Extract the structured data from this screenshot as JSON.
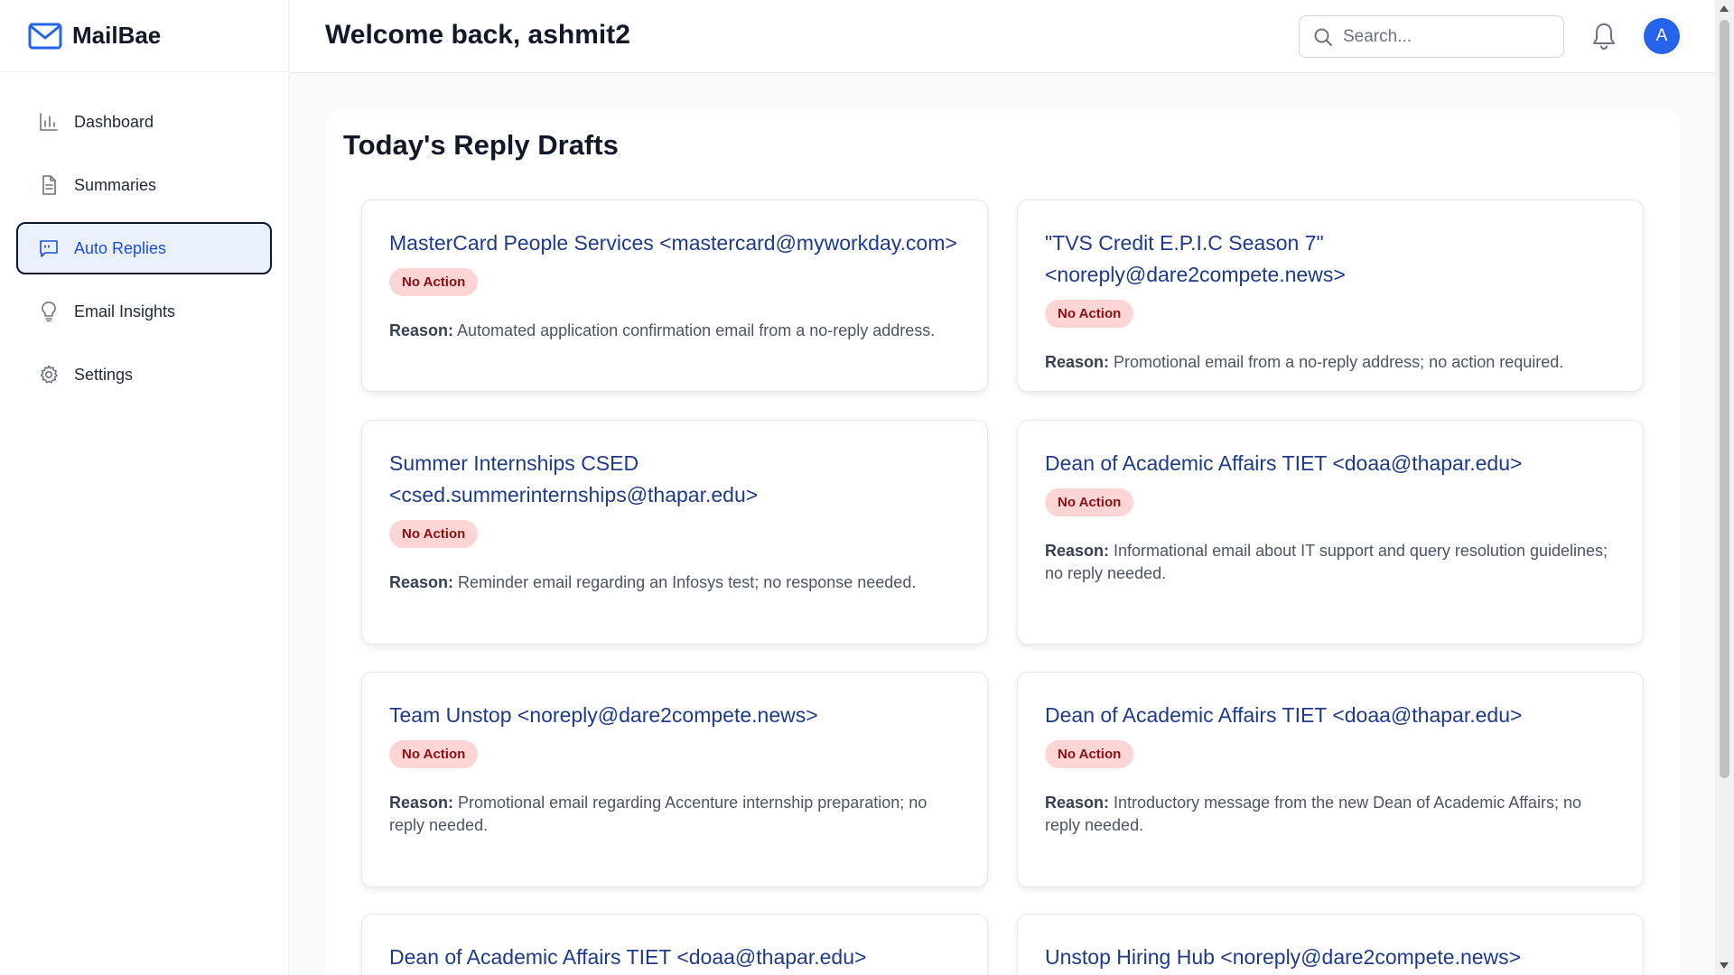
{
  "app": {
    "name": "MailBae"
  },
  "sidebar": {
    "items": [
      {
        "label": "Dashboard",
        "icon": "bar-chart-icon"
      },
      {
        "label": "Summaries",
        "icon": "document-icon"
      },
      {
        "label": "Auto Replies",
        "icon": "message-reply-icon",
        "active": true
      },
      {
        "label": "Email Insights",
        "icon": "lightbulb-icon"
      },
      {
        "label": "Settings",
        "icon": "gear-icon"
      }
    ]
  },
  "header": {
    "welcome": "Welcome back, ashmit2",
    "search_placeholder": "Search...",
    "avatar_initial": "A"
  },
  "main": {
    "title": "Today's Reply Drafts",
    "reason_label": "Reason:",
    "cards": [
      {
        "sender": "MasterCard People Services <mastercard@myworkday.com>",
        "status": "No Action",
        "reason": "Automated application confirmation email from a no-reply address."
      },
      {
        "sender": "\"TVS Credit E.P.I.C Season 7\" <noreply@dare2compete.news>",
        "status": "No Action",
        "reason": "Promotional email from a no-reply address; no action required."
      },
      {
        "sender": "Summer Internships CSED <csed.summerinternships@thapar.edu>",
        "status": "No Action",
        "reason": "Reminder email regarding an Infosys test; no response needed."
      },
      {
        "sender": "Dean of Academic Affairs TIET <doaa@thapar.edu>",
        "status": "No Action",
        "reason": "Informational email about IT support and query resolution guidelines; no reply needed."
      },
      {
        "sender": "Team Unstop <noreply@dare2compete.news>",
        "status": "No Action",
        "reason": "Promotional email regarding Accenture internship preparation; no reply needed."
      },
      {
        "sender": "Dean of Academic Affairs TIET <doaa@thapar.edu>",
        "status": "No Action",
        "reason": "Introductory message from the new Dean of Academic Affairs; no reply needed."
      },
      {
        "sender": "Dean of Academic Affairs TIET <doaa@thapar.edu>"
      },
      {
        "sender": "Unstop Hiring Hub <noreply@dare2compete.news>"
      }
    ]
  },
  "colors": {
    "accent": "#2563eb",
    "active_nav_bg": "#eaf1fd",
    "card_title": "#1e3a8a",
    "badge_bg": "#fdd5d5",
    "badge_text": "#8b1010"
  }
}
